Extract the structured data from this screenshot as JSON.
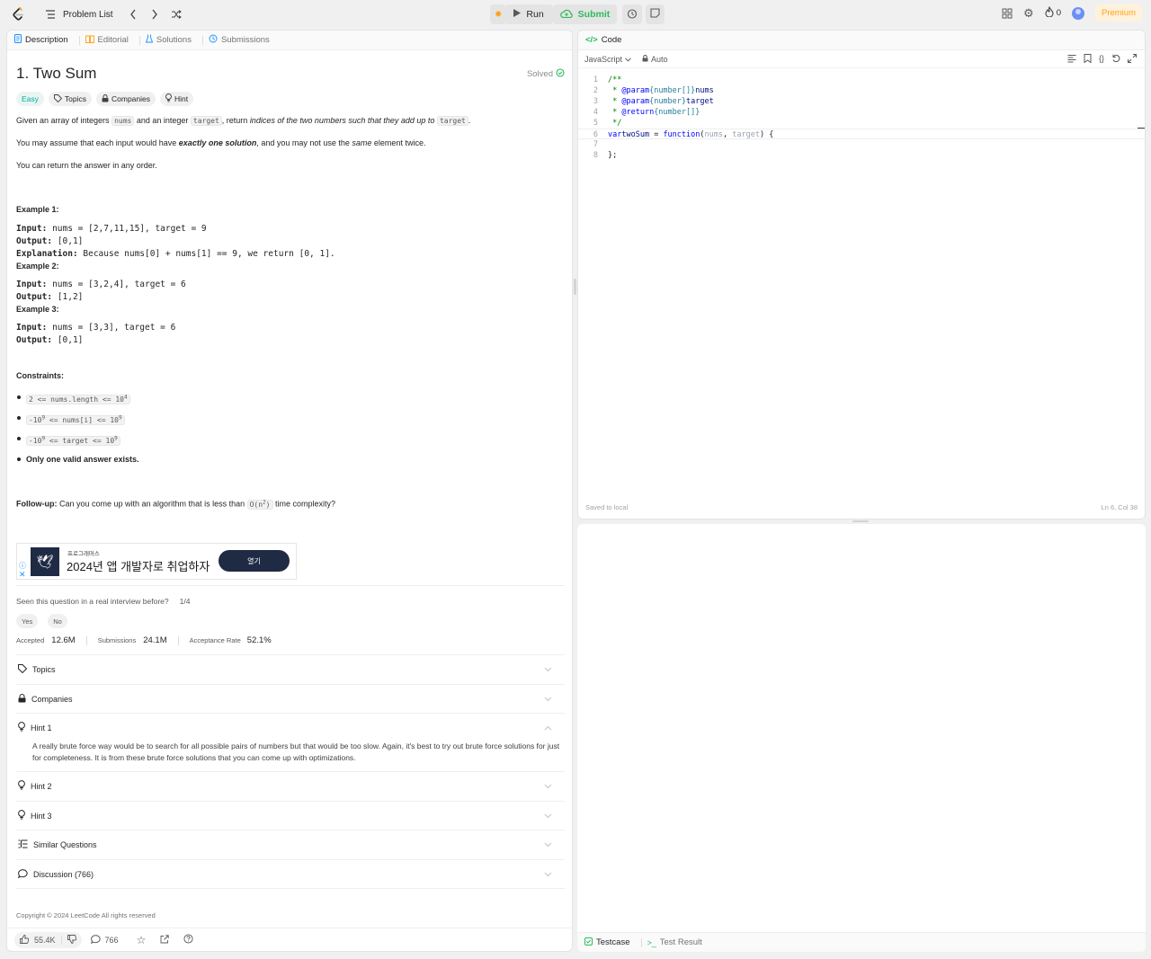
{
  "topbar": {
    "problem_list": "Problem List",
    "run": "Run",
    "submit": "Submit",
    "streak": "0",
    "premium": "Premium"
  },
  "left_tabs": [
    {
      "label": "Description",
      "icon": "description-icon"
    },
    {
      "label": "Editorial",
      "icon": "book-icon"
    },
    {
      "label": "Solutions",
      "icon": "flask-icon"
    },
    {
      "label": "Submissions",
      "icon": "history-icon"
    }
  ],
  "problem": {
    "title": "1. Two Sum",
    "solved": "Solved",
    "difficulty": "Easy",
    "tags": {
      "topics": "Topics",
      "companies": "Companies",
      "hint": "Hint"
    },
    "desc1": {
      "a": "Given an array of integers ",
      "b": "nums",
      "c": " and an integer ",
      "d": "target",
      "e": ", return ",
      "f": "indices of the two numbers such that they add up to",
      "g": " ",
      "h": "target",
      "i": "."
    },
    "desc2": {
      "a": "You may assume that each input would have ",
      "b": "exactly one solution",
      "c": ", and you may not use the ",
      "d": "same",
      "e": " element twice."
    },
    "desc3": "You can return the answer in any order.",
    "examples": [
      {
        "title": "Example 1:",
        "input": "nums = [2,7,11,15], target = 9",
        "output": "[0,1]",
        "explanation": "Because nums[0] + nums[1] == 9, we return [0, 1]."
      },
      {
        "title": "Example 2:",
        "input": "nums = [3,2,4], target = 6",
        "output": "[1,2]"
      },
      {
        "title": "Example 3:",
        "input": "nums = [3,3], target = 6",
        "output": "[0,1]"
      }
    ],
    "labels": {
      "input": "Input:",
      "output": "Output:",
      "explanation": "Explanation:"
    },
    "constraints_title": "Constraints:",
    "constraints": [
      {
        "a": "2 <= nums.length <= 10",
        "sup": "4"
      },
      {
        "a": "-10",
        "sup1": "9",
        "b": " <= nums[i] <= 10",
        "sup2": "9"
      },
      {
        "a": "-10",
        "sup1": "9",
        "b": " <= target <= 10",
        "sup2": "9"
      }
    ],
    "constraint_last": "Only one valid answer exists.",
    "followup": {
      "label": "Follow-up:",
      "a": " Can you come up with an algorithm that is less than ",
      "code": "O(n",
      "sup": "2",
      "code_end": ")",
      "b": " time complexity?"
    }
  },
  "ad": {
    "brand": "프로그래머스",
    "text": "2024년 앱 개발자로 취업하자",
    "button": "열기"
  },
  "interview": {
    "question": "Seen this question in a real interview before?",
    "count": "1/4",
    "yes": "Yes",
    "no": "No"
  },
  "stats": [
    {
      "label": "Accepted",
      "value": "12.6M"
    },
    {
      "label": "Submissions",
      "value": "24.1M"
    },
    {
      "label": "Acceptance Rate",
      "value": "52.1%"
    }
  ],
  "accordions": {
    "topics": "Topics",
    "companies": "Companies",
    "hint1": "Hint 1",
    "hint1_body": "A really brute force way would be to search for all possible pairs of numbers but that would be too slow. Again, it's best to try out brute force solutions for just for completeness. It is from these brute force solutions that you can come up with optimizations.",
    "hint2": "Hint 2",
    "hint3": "Hint 3",
    "similar": "Similar Questions",
    "discussion": "Discussion (766)"
  },
  "copyright": "Copyright © 2024 LeetCode All rights reserved",
  "footer": {
    "likes": "55.4K",
    "comments": "766"
  },
  "code": {
    "tab": "Code",
    "language": "JavaScript",
    "auto": "Auto",
    "line_numbers": [
      "1",
      "2",
      "3",
      "4",
      "5",
      "6",
      "7",
      "8"
    ],
    "status": "Saved to local",
    "cursor": "Ln 6, Col 38"
  },
  "bottom_tabs": {
    "testcase": "Testcase",
    "result": "Test Result"
  },
  "colors": {
    "accent": "#2cbb5d",
    "easy": "#00af9b",
    "premium": "#ffa116"
  }
}
